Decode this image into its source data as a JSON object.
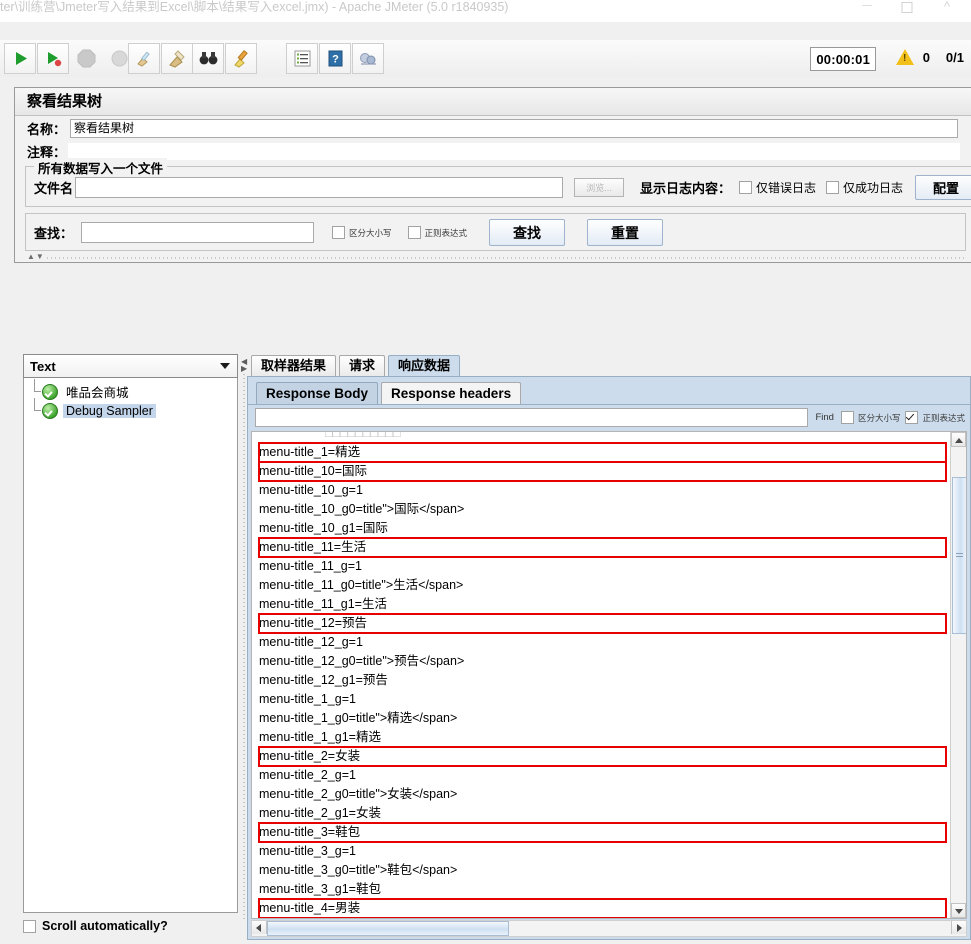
{
  "window": {
    "title": "ter\\训练营\\Jmeter写入结果到Excel\\脚本\\结果写入excel.jmx) - Apache JMeter (5.0 r1840935)",
    "minimize": "–",
    "maximize": "□",
    "close": "⌃"
  },
  "toolbar": {
    "buttons": [
      {
        "name": "start",
        "icon": "play-icon"
      },
      {
        "name": "start-no-pauses",
        "icon": "play-no-pause-icon"
      },
      {
        "name": "stop",
        "icon": "stop-icon"
      },
      {
        "name": "shutdown",
        "icon": "shutdown-icon"
      },
      {
        "name": "clear",
        "icon": "broom-clear-icon"
      },
      {
        "name": "clear-all",
        "icon": "broom-clear-all-icon"
      },
      {
        "name": "search",
        "icon": "binoculars-icon"
      },
      {
        "name": "reset-search",
        "icon": "reset-search-icon"
      },
      {
        "name": "function-helper",
        "icon": "list-icon"
      },
      {
        "name": "help",
        "icon": "help-icon"
      },
      {
        "name": "undo-redo",
        "icon": "misc-icon"
      }
    ],
    "runtime": "00:00:01",
    "warn_icon": "warning-triangle-icon",
    "error_count": "0",
    "threads": "0/1"
  },
  "panel": {
    "title": "察看结果树",
    "name_label": "名称：",
    "name_value": "察看结果树",
    "comment_label": "注释：",
    "comment_value": "",
    "fieldset_legend": "所有数据写入一个文件",
    "filename_label": "文件名",
    "filename_value": "",
    "browse_label": "浏览...",
    "log_display_label": "显示日志内容：",
    "only_error_log": "仅错误日志",
    "only_success_log": "仅成功日志",
    "configure_label": "配置"
  },
  "search": {
    "label": "查找：",
    "value": "",
    "case_sensitive": "区分大小写",
    "regex": "正则表达式",
    "find_button": "查找",
    "reset_button": "重置"
  },
  "left": {
    "renderer_selected": "Text",
    "tree": [
      {
        "label": "唯品会商城",
        "selected": false,
        "icon": "success-circle-icon"
      },
      {
        "label": "Debug Sampler",
        "selected": true,
        "icon": "success-circle-icon"
      }
    ],
    "scroll_automatically": "Scroll automatically?"
  },
  "right": {
    "tabs": [
      {
        "label": "取样器结果",
        "active": false
      },
      {
        "label": "请求",
        "active": false
      },
      {
        "label": "响应数据",
        "active": true
      }
    ],
    "subtabs": [
      {
        "label": "Response Body",
        "active": true
      },
      {
        "label": "Response headers",
        "active": false
      }
    ],
    "find": {
      "value": "",
      "button": "Find",
      "case_sensitive": "区分大小写",
      "case_sensitive_checked": false,
      "regex": "正则表达式",
      "regex_checked": true
    },
    "body_lines": [
      {
        "text": "□□□□□□□□□□",
        "highlight": false,
        "clipped": true
      },
      {
        "text": "menu-title_1=精选",
        "highlight": true
      },
      {
        "text": "menu-title_10=国际",
        "highlight": true
      },
      {
        "text": "menu-title_10_g=1",
        "highlight": false
      },
      {
        "text": "menu-title_10_g0=title\">国际</span>",
        "highlight": false
      },
      {
        "text": "menu-title_10_g1=国际",
        "highlight": false
      },
      {
        "text": "menu-title_11=生活",
        "highlight": true
      },
      {
        "text": "menu-title_11_g=1",
        "highlight": false
      },
      {
        "text": "menu-title_11_g0=title\">生活</span>",
        "highlight": false
      },
      {
        "text": "menu-title_11_g1=生活",
        "highlight": false
      },
      {
        "text": "menu-title_12=预告",
        "highlight": true
      },
      {
        "text": "menu-title_12_g=1",
        "highlight": false
      },
      {
        "text": "menu-title_12_g0=title\">预告</span>",
        "highlight": false
      },
      {
        "text": "menu-title_12_g1=预告",
        "highlight": false
      },
      {
        "text": "menu-title_1_g=1",
        "highlight": false
      },
      {
        "text": "menu-title_1_g0=title\">精选</span>",
        "highlight": false
      },
      {
        "text": "menu-title_1_g1=精选",
        "highlight": false
      },
      {
        "text": "menu-title_2=女装",
        "highlight": true
      },
      {
        "text": "menu-title_2_g=1",
        "highlight": false
      },
      {
        "text": "menu-title_2_g0=title\">女装</span>",
        "highlight": false
      },
      {
        "text": "menu-title_2_g1=女装",
        "highlight": false
      },
      {
        "text": "menu-title_3=鞋包",
        "highlight": true
      },
      {
        "text": "menu-title_3_g=1",
        "highlight": false
      },
      {
        "text": "menu-title_3_g0=title\">鞋包</span>",
        "highlight": false
      },
      {
        "text": "menu-title_3_g1=鞋包",
        "highlight": false
      },
      {
        "text": "menu-title_4=男装",
        "highlight": true
      }
    ]
  },
  "colors": {
    "highlight_red": "#e60000",
    "tab_active_blue": "#ccdcec",
    "selection_blue": "#c3d5ea",
    "panel_gray": "#f0f0f0"
  }
}
